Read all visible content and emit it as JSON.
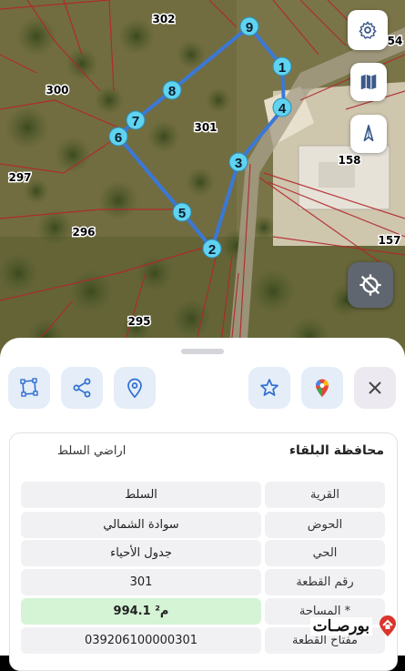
{
  "map": {
    "parcel_numbers": [
      "302",
      "54",
      "300",
      "301",
      "297",
      "296",
      "158",
      "157",
      "295"
    ],
    "vertex_labels": [
      "1",
      "2",
      "3",
      "4",
      "5",
      "6",
      "7",
      "8",
      "9"
    ],
    "polygon_color": "#3a78d8",
    "vertex_color": "#5fd3f0",
    "icons": {
      "settings": "gear-icon",
      "map_layers": "map-icon",
      "north": "compass-north-icon",
      "location_off": "location-off-icon"
    }
  },
  "actions": {
    "icons": [
      "polygon-shape-icon",
      "share-icon",
      "location-pin-icon",
      "star-icon",
      "google-maps-icon",
      "close-icon"
    ]
  },
  "info": {
    "governorate_label": "محافظة البلقاء",
    "governorate_value": "اراضي السلط",
    "rows": [
      {
        "label": "القرية",
        "value": "السلط"
      },
      {
        "label": "الحوض",
        "value": "سوادة الشمالي"
      },
      {
        "label": "الحي",
        "value": "جدول الأحياء"
      },
      {
        "label": "رقم القطعة",
        "value": "301"
      },
      {
        "label": "المساحة *",
        "value": "994.1 م²"
      },
      {
        "label": "مفتاح القطعة",
        "value": "039206100000301"
      }
    ]
  },
  "logo": {
    "text": "بورصـات"
  },
  "colors": {
    "accent_blue": "#2f6fd0",
    "area_green": "#d4f4d5",
    "sheet_bg": "#ffffff"
  }
}
